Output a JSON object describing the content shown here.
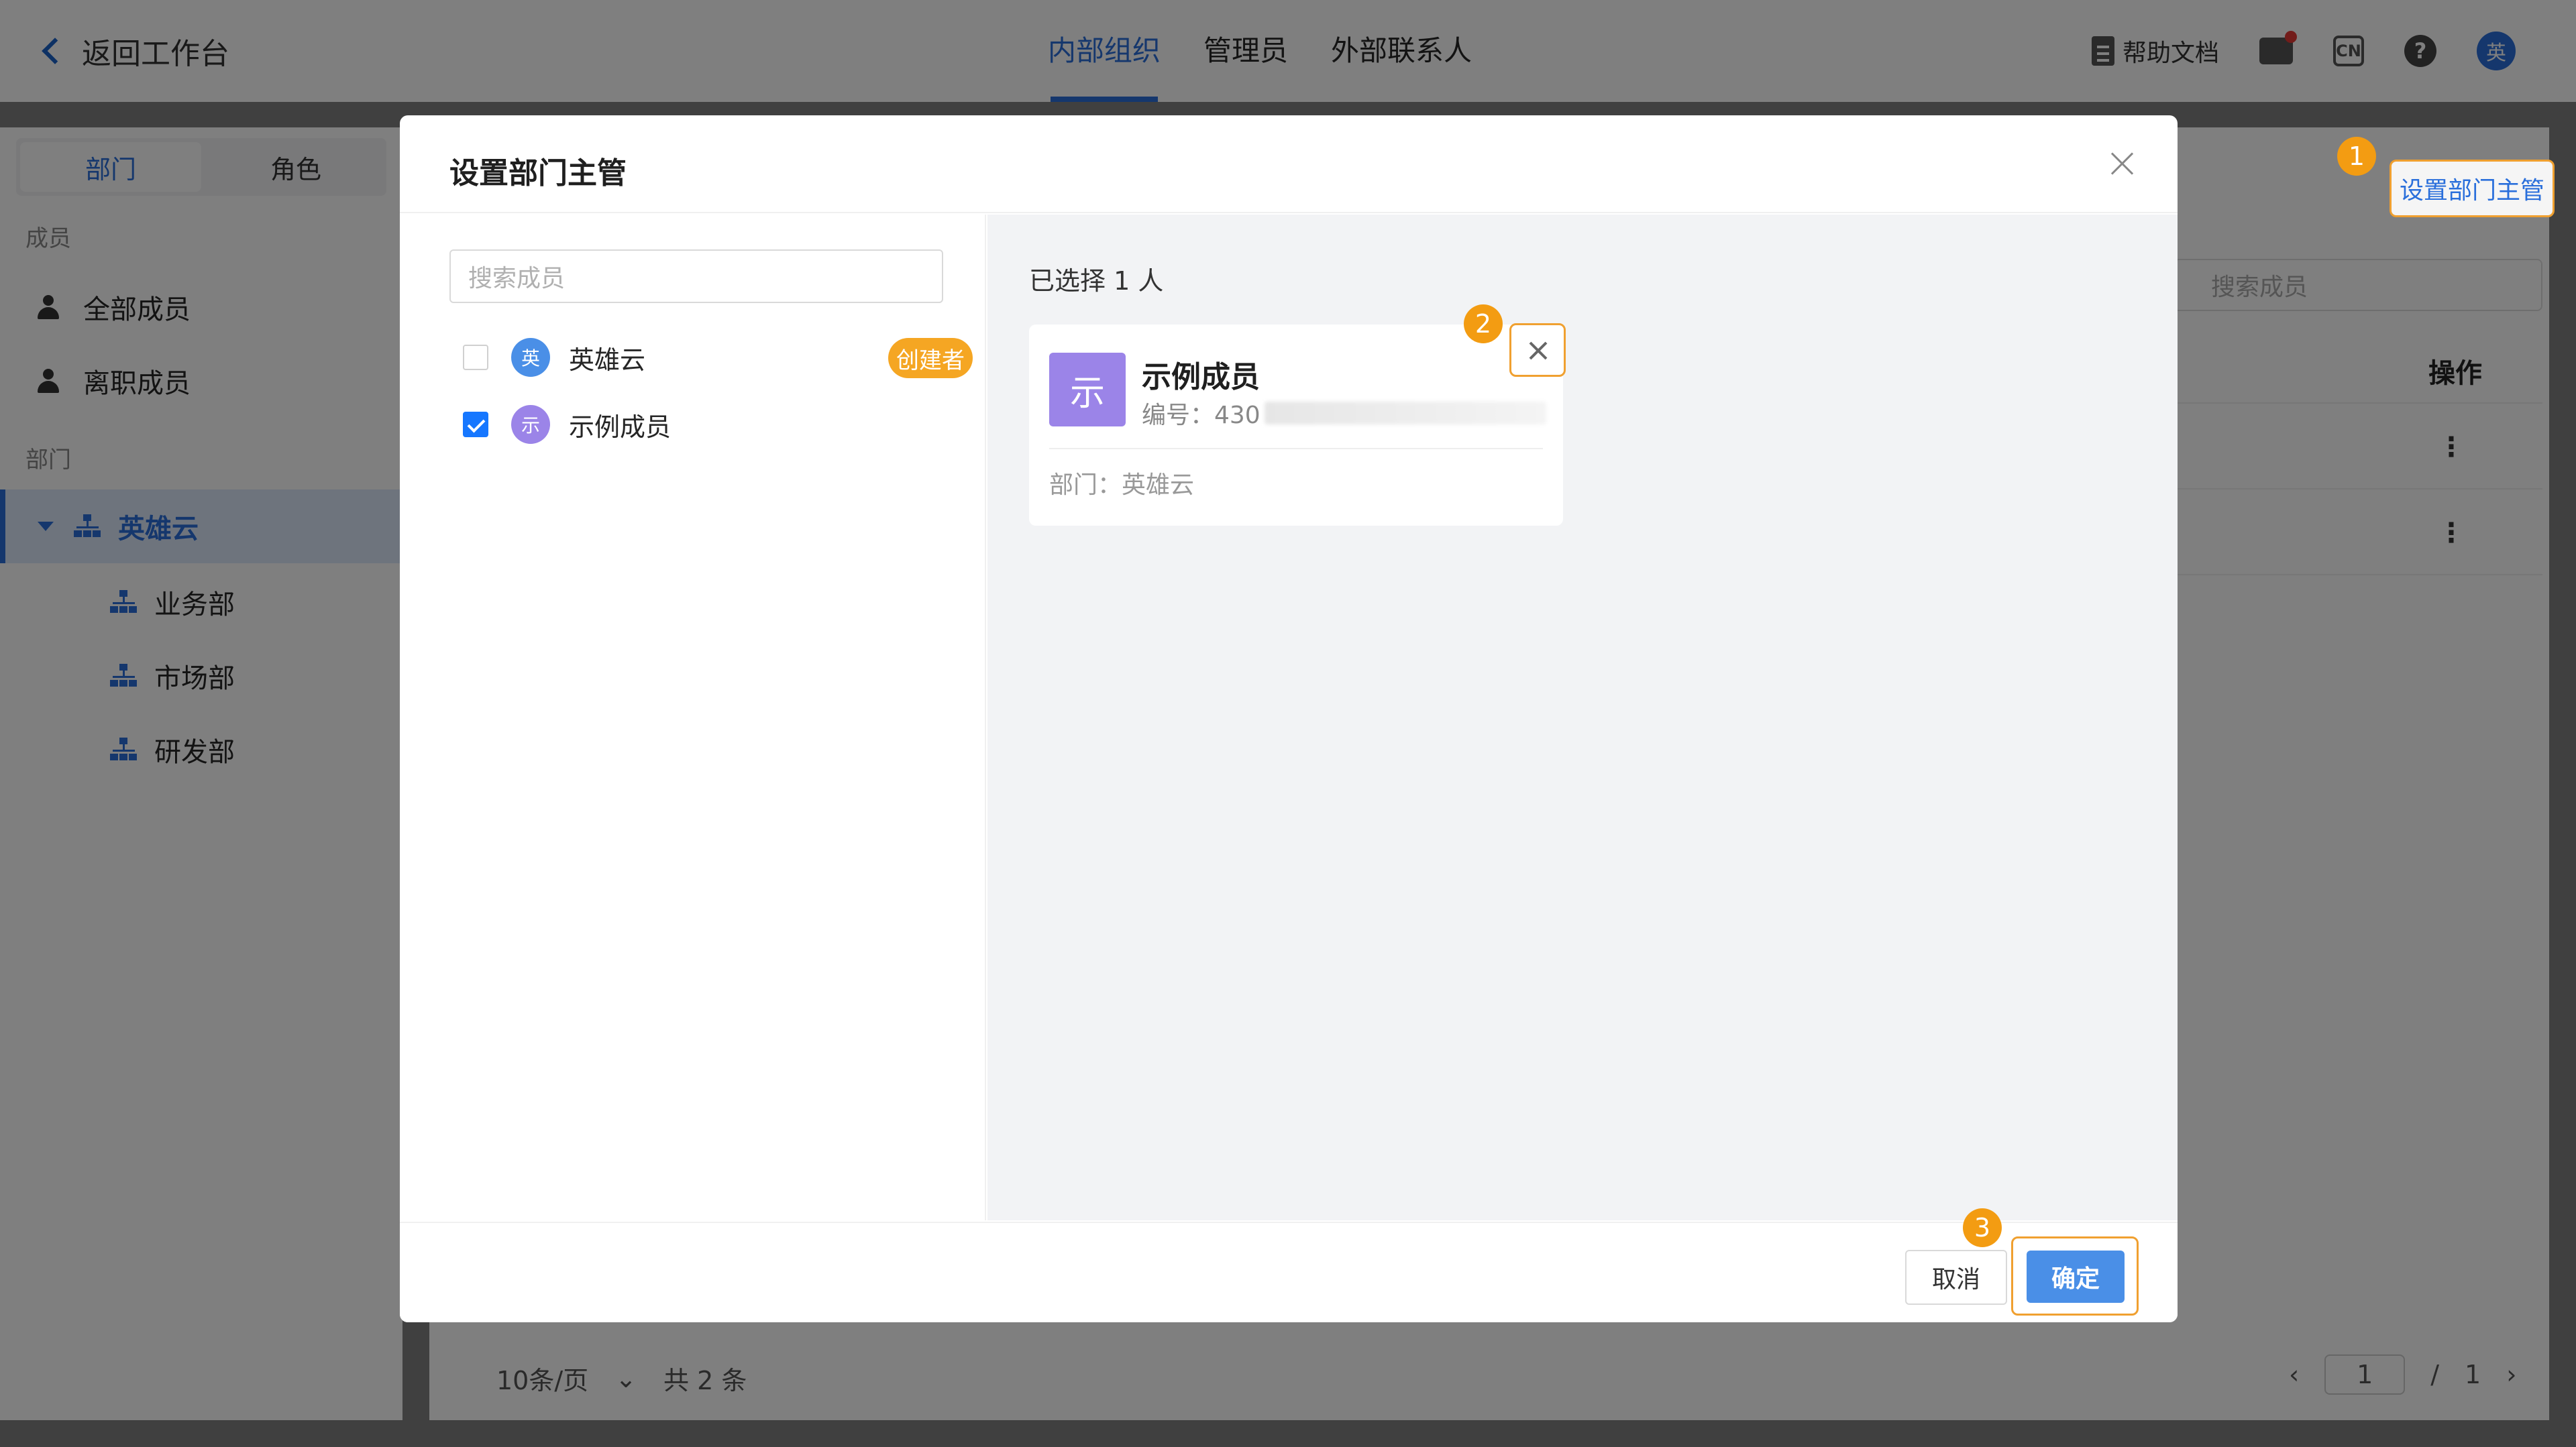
{
  "header": {
    "back_label": "返回工作台",
    "tabs": [
      {
        "label": "内部组织",
        "active": true
      },
      {
        "label": "管理员",
        "active": false
      },
      {
        "label": "外部联系人",
        "active": false
      }
    ],
    "help_label": "帮助文档",
    "lang_icon_text": "CN",
    "help_icon_text": "?",
    "avatar_text": "英"
  },
  "sidebar": {
    "segments": [
      "部门",
      "角色"
    ],
    "members_label": "成员",
    "member_items": [
      "全部成员",
      "离职成员"
    ],
    "dept_label": "部门",
    "root_dept": "英雄云",
    "sub_depts": [
      "业务部",
      "市场部",
      "研发部"
    ]
  },
  "main": {
    "set_manager_label": "设置部门主管",
    "search_placeholder": "搜索成员",
    "op_col": "操作",
    "row_menu": "⋮",
    "pager": {
      "page_size": "10条/页",
      "total": "共 2 条",
      "current": "1",
      "sep": "/",
      "pages": "1"
    }
  },
  "steps": [
    "1",
    "2",
    "3"
  ],
  "modal": {
    "title": "设置部门主管",
    "search_placeholder": "搜索成员",
    "members": [
      {
        "avatar": "英",
        "name": "英雄云",
        "checked": false,
        "badge": "创建者",
        "color": "#4a8fe7"
      },
      {
        "avatar": "示",
        "name": "示例成员",
        "checked": true,
        "badge": "",
        "color": "#9b84e8"
      }
    ],
    "selected_count": "已选择 1 人",
    "card": {
      "avatar": "示",
      "name": "示例成员",
      "id_label": "编号：430",
      "dept": "部门：英雄云"
    },
    "cancel_label": "取消",
    "ok_label": "确定"
  },
  "colors": {
    "accent": "#2a6fdb",
    "highlight": "#f0a030",
    "badge": "#f5a623"
  }
}
